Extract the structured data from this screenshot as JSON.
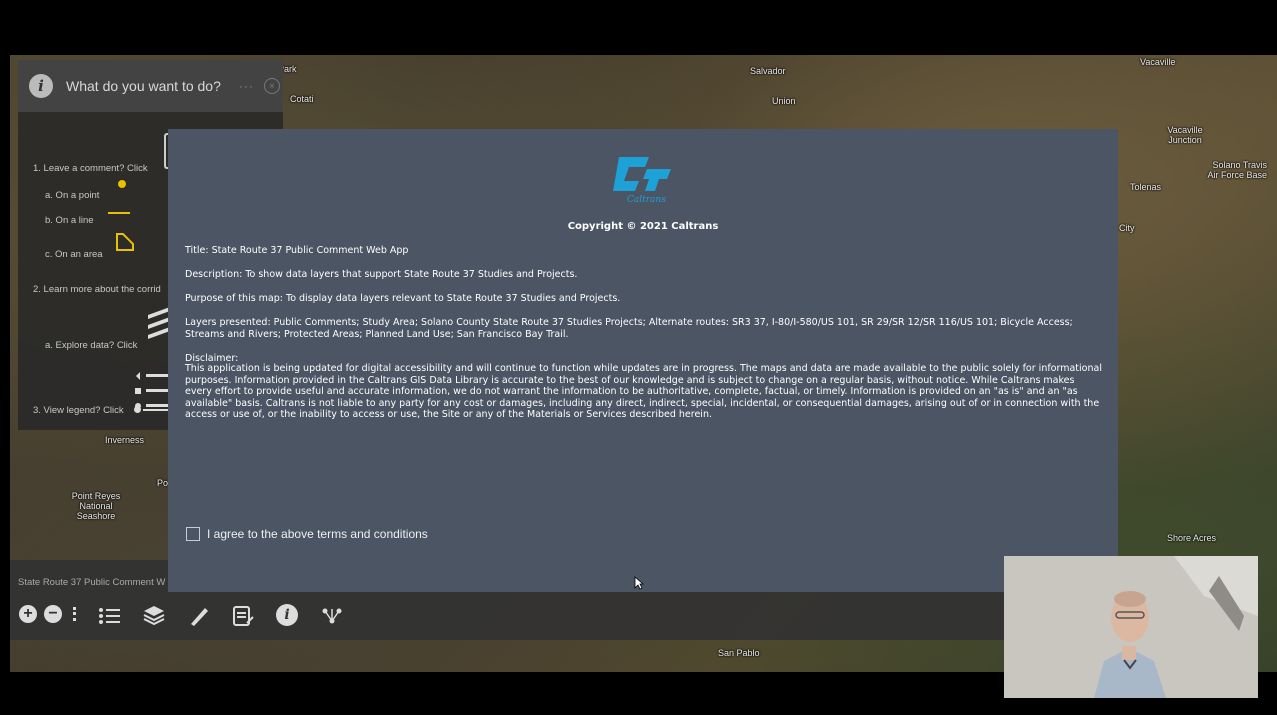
{
  "map": {
    "labels": [
      {
        "id": "rohnert",
        "text": "hnert Park"
      },
      {
        "id": "cotati",
        "text": "Cotati"
      },
      {
        "id": "salvador",
        "text": "Salvador"
      },
      {
        "id": "union",
        "text": "Union"
      },
      {
        "id": "vacavillejct",
        "text": "Vacaville Junction"
      },
      {
        "id": "travis",
        "text": "Solano Travis Air Force Base"
      },
      {
        "id": "tolenas",
        "text": "Tolenas"
      },
      {
        "id": "city",
        "text": "City"
      },
      {
        "id": "inverness",
        "text": "Inverness"
      },
      {
        "id": "pointreyes",
        "text": "Point Reyes National Seashore"
      },
      {
        "id": "po",
        "text": "Po"
      },
      {
        "id": "shoreacres",
        "text": "Shore Acres"
      },
      {
        "id": "sanpablo",
        "text": "San Pablo"
      },
      {
        "id": "vacaville",
        "text": "Vacaville"
      }
    ]
  },
  "panel": {
    "title": "What do you want to do?",
    "dots": "···",
    "close": "×",
    "items": {
      "leave_comment": "1. Leave a comment?  Click",
      "on_point": "a. On a point",
      "on_line": "b. On a line",
      "on_area": "c. On an area",
      "learn_more": "2. Learn more about the corrid",
      "explore": "a. Explore data? Click",
      "legend": "3. View legend? Click"
    }
  },
  "toolbar": {
    "app_name": "State Route 37 Public Comment W",
    "zoom_in": "+",
    "zoom_out": "−"
  },
  "modal": {
    "logo_text": "Caltrans",
    "copyright": "Copyright © 2021 Caltrans",
    "title": "Title: State Route 37 Public Comment Web App",
    "description": "Description: To show data layers that support State Route 37 Studies and Projects.",
    "purpose": "Purpose of this map: To display data layers relevant to State Route 37 Studies and Projects.",
    "layers": "Layers presented: Public Comments; Study Area; Solano County State Route 37 Studies Projects; Alternate routes: SR3 37, I-80/I-580/US 101, SR 29/SR 12/SR 116/US 101; Bicycle Access; Streams and Rivers; Protected Areas; Planned Land Use; San Francisco Bay Trail.",
    "disclaimer_heading": "Disclaimer:",
    "disclaimer": "This application is being updated for digital accessibility and will continue to function while updates are in progress. The maps and data are made available to the public solely for informational purposes. Information provided in the Caltrans GIS Data Library is accurate to the best of our knowledge and is subject to change on a regular basis, without notice. While Caltrans makes every effort to provide useful and accurate information, we do not warrant the information to be authoritative, complete, factual, or timely. Information is provided on an \"as is\" and an \"as available\" basis. Caltrans is not liable to any party for any cost or damages, including any direct, indirect, special, incidental, or consequential damages, arising out of or in connection with the access or use of, or the inability to access or use, the Site or any of the Materials or Services described herein.",
    "agree_label": "I agree to the above terms and conditions",
    "agree_checked": false
  },
  "colors": {
    "modal_bg": "#4b5563",
    "logo_blue": "#1da1d6"
  }
}
